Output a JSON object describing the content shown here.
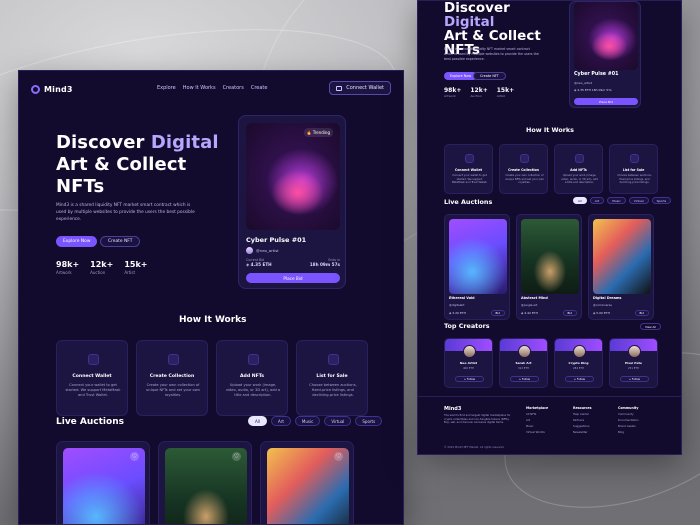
{
  "main": {
    "nav": {
      "brand": "Mind3",
      "links": [
        "Explore",
        "How It Works",
        "Creators",
        "Create"
      ],
      "connect_wallet": "Connect Wallet"
    },
    "hero": {
      "title_line1_a": "Discover",
      "title_line1_b": "Digital",
      "title_line2": "Art & Collect",
      "title_line3": "NFTs",
      "subtitle": "Mind3 is a shared liquidity NFT market smart contract which is used by multiple websites to provide the users the best possible experience.",
      "primary_btn": "Explore Now",
      "secondary_btn": "Create NFT",
      "stats": [
        {
          "value": "98k+",
          "label": "Artwork"
        },
        {
          "value": "12k+",
          "label": "Auction"
        },
        {
          "value": "15k+",
          "label": "Artist"
        }
      ],
      "featured": {
        "badge": "🔥 Trending",
        "title": "Cyber Pulse #01",
        "creator": "@neo_artist",
        "current_bid_label": "Current Bid",
        "current_bid": "◈ 4.35 ETH",
        "ends_label": "Ends in",
        "ends_in": "18h 09m 57s",
        "place_bid": "Place Bid"
      }
    },
    "how": {
      "title": "How It Works",
      "cards": [
        {
          "title": "Connect Wallet",
          "desc": "Connect your wallet to get started. We support MetaMask and Trust Wallet."
        },
        {
          "title": "Create Collection",
          "desc": "Create your own collection of unique NFTs and set your own royalties."
        },
        {
          "title": "Add NFTs",
          "desc": "Upload your work (image, video, audio, or 3D art), add a title and description."
        },
        {
          "title": "List for Sale",
          "desc": "Choose between auctions, fixed-price listings, and declining-price listings."
        }
      ]
    },
    "live": {
      "title": "Live Auctions",
      "filters": [
        "All",
        "Art",
        "Music",
        "Virtual",
        "Sports"
      ],
      "active_filter": "All"
    }
  },
  "mini": {
    "hero": {
      "title_line1_a": "Discover",
      "title_line1_b": "Digital",
      "title_line2": "Art & Collect",
      "title_line3": "NFTs",
      "subtitle": "Mind3 is a shared liquidity NFT market smart contract which is used by multiple websites to provide the users the best possible experience.",
      "primary_btn": "Explore Now",
      "secondary_btn": "Create NFT",
      "stats": [
        {
          "value": "98k+",
          "label": "Artwork"
        },
        {
          "value": "12k+",
          "label": "Auction"
        },
        {
          "value": "15k+",
          "label": "Artist"
        }
      ],
      "featured": {
        "title": "Cyber Pulse #01",
        "creator": "@neo_artist",
        "bid": "◈ 4.35 ETH  18h 09m 57s",
        "place_bid": "Place Bid"
      }
    },
    "how": {
      "title": "How It Works",
      "cards": [
        {
          "title": "Connect Wallet",
          "desc": "Connect your wallet to get started. We support MetaMask and Trust Wallet."
        },
        {
          "title": "Create Collection",
          "desc": "Create your own collection of unique NFTs and set your own royalties."
        },
        {
          "title": "Add NFTs",
          "desc": "Upload your work (image, video, audio, or 3D art), add a title and description."
        },
        {
          "title": "List for Sale",
          "desc": "Choose between auctions, fixed-price listings, and declining-price listings."
        }
      ]
    },
    "live": {
      "title": "Live Auctions",
      "filters": [
        "All",
        "Art",
        "Music",
        "Virtual",
        "Sports"
      ],
      "cards": [
        {
          "title": "Ethereal Void",
          "creator": "@digitalart",
          "price": "◈ 3.20 ETH",
          "bid": "Bid"
        },
        {
          "title": "Abstract Mind",
          "creator": "@jungle.art",
          "price": "◈ 4.42 ETH",
          "bid": "Bid"
        },
        {
          "title": "Digital Dreams",
          "creator": "@comicverse",
          "price": "◈ 5.00 ETH",
          "bid": "Bid"
        }
      ]
    },
    "creators": {
      "title": "Top Creators",
      "view_all": "View All",
      "items": [
        {
          "name": "Neo Artist",
          "sales": "400 ETH",
          "follow": "+ Follow"
        },
        {
          "name": "Sarah Art",
          "sales": "312 ETH",
          "follow": "+ Follow"
        },
        {
          "name": "Crypto King",
          "sales": "284 ETH",
          "follow": "+ Follow"
        },
        {
          "name": "Pixel Pete",
          "sales": "251 ETH",
          "follow": "+ Follow"
        }
      ]
    },
    "footer": {
      "brand": "Mind3",
      "desc": "The world's first and largest digital marketplace for crypto collectibles and non-fungible tokens (NFTs). Buy, sell, and discover exclusive digital items.",
      "copyright": "© 2024 Mind3 NFT Market. All rights reserved.",
      "columns": [
        {
          "heading": "Marketplace",
          "items": [
            "All NFTs",
            "Art",
            "Music",
            "Virtual Worlds"
          ]
        },
        {
          "heading": "Resources",
          "items": [
            "Help Center",
            "Partners",
            "Suggestions",
            "Newsletter"
          ]
        },
        {
          "heading": "Community",
          "items": [
            "Community",
            "Documentation",
            "Brand Assets",
            "Blog"
          ]
        }
      ]
    }
  }
}
